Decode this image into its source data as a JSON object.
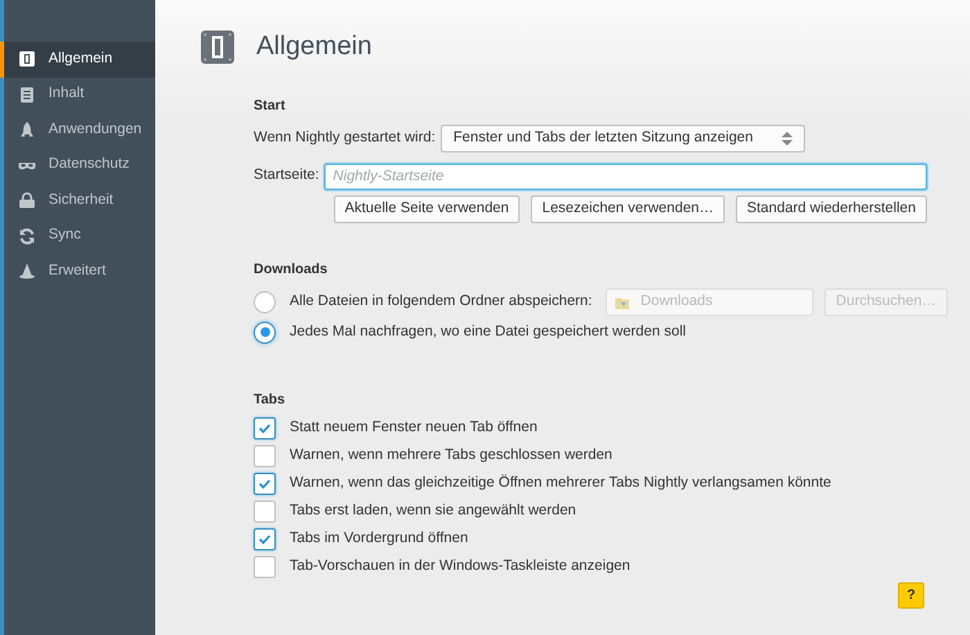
{
  "sidebar": {
    "items": [
      {
        "label": "Allgemein",
        "kind": "general",
        "selected": true
      },
      {
        "label": "Inhalt",
        "kind": "content",
        "selected": false
      },
      {
        "label": "Anwendungen",
        "kind": "apps",
        "selected": false
      },
      {
        "label": "Datenschutz",
        "kind": "privacy",
        "selected": false
      },
      {
        "label": "Sicherheit",
        "kind": "security",
        "selected": false
      },
      {
        "label": "Sync",
        "kind": "sync",
        "selected": false
      },
      {
        "label": "Erweitert",
        "kind": "advanced",
        "selected": false
      }
    ]
  },
  "page_title": "Allgemein",
  "start": {
    "heading": "Start",
    "startup_label": "Wenn Nightly gestartet wird:",
    "startup_value": "Fenster und Tabs der letzten Sitzung anzeigen",
    "homepage_label": "Startseite:",
    "homepage_placeholder": "Nightly-Startseite",
    "buttons": [
      "Aktuelle Seite verwenden",
      "Lesezeichen verwenden…",
      "Standard wiederherstellen"
    ]
  },
  "downloads": {
    "heading": "Downloads",
    "options": [
      {
        "label": "Alle Dateien in folgendem Ordner abspeichern:",
        "selected": false
      },
      {
        "label": "Jedes Mal nachfragen, wo eine Datei gespeichert werden soll",
        "selected": true
      }
    ],
    "folder": "Downloads",
    "browse_button": "Durchsuchen…",
    "folder_disabled": true
  },
  "tabs": {
    "heading": "Tabs",
    "options": [
      {
        "label": "Statt neuem Fenster neuen Tab öffnen",
        "checked": true
      },
      {
        "label": "Warnen, wenn mehrere Tabs geschlossen werden",
        "checked": false
      },
      {
        "label": "Warnen, wenn das gleichzeitige Öffnen mehrerer Tabs Nightly verlangsamen könnte",
        "checked": true
      },
      {
        "label": "Tabs erst laden, wenn sie angewählt werden",
        "checked": false
      },
      {
        "label": "Tabs im Vordergrund öffnen",
        "checked": true
      },
      {
        "label": "Tab-Vorschauen in der Windows-Taskleiste anzeigen",
        "checked": false
      }
    ]
  },
  "help_button": "?"
}
